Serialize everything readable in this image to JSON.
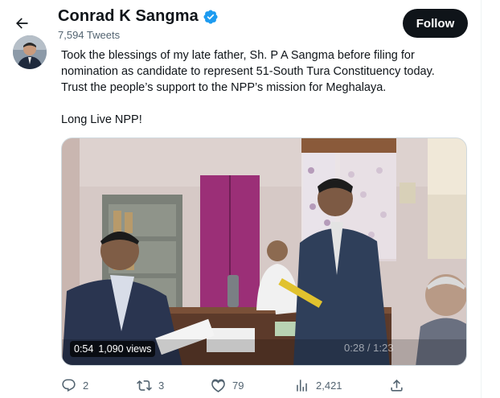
{
  "header": {
    "name": "Conrad K Sangma",
    "tweets_count": "7,594 Tweets",
    "follow_label": "Follow"
  },
  "tweet": {
    "line1": "Took the blessings of my late father, Sh. P A Sangma before filing for",
    "line2": "nomination as candidate to represent 51-South Tura Constituency today.",
    "line3": "Trust the people’s support to the NPP’s mission for Meghalaya.",
    "line4": "Long Live NPP!"
  },
  "video": {
    "duration_elapsed": "0:54",
    "views": "1,090 views",
    "timestamp": "0:28 / 1:23"
  },
  "actions": {
    "replies": "2",
    "retweets": "3",
    "likes": "79",
    "views": "2,421"
  },
  "colors": {
    "accent_verified": "#1d9bf0",
    "text_secondary": "#536471",
    "follow_bg": "#0f1419"
  },
  "icons": [
    "back-arrow-icon",
    "verified-badge-icon",
    "reply-icon",
    "retweet-icon",
    "like-icon",
    "views-icon",
    "share-icon"
  ]
}
